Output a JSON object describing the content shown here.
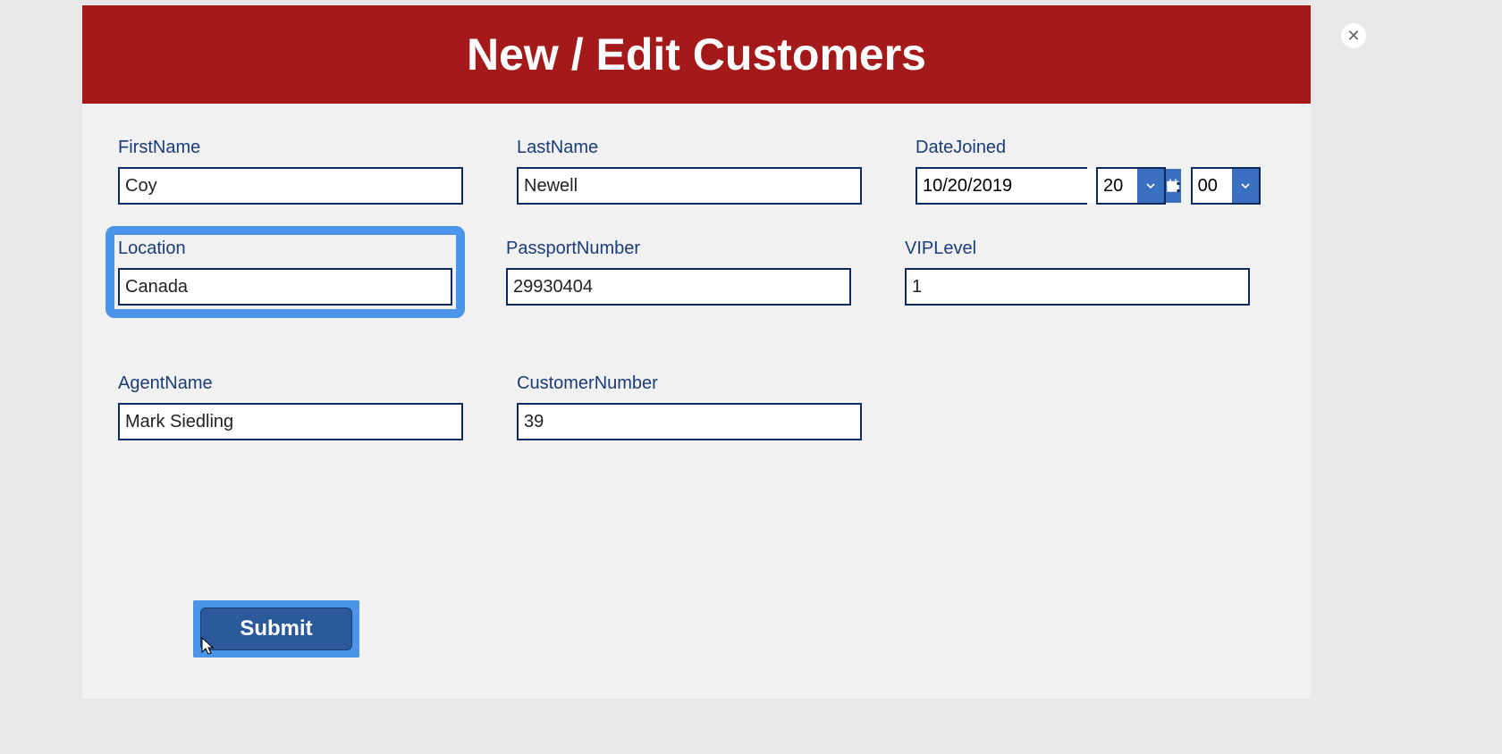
{
  "modal": {
    "title": "New / Edit Customers",
    "close_label": "✕"
  },
  "form": {
    "firstName": {
      "label": "FirstName",
      "value": "Coy"
    },
    "lastName": {
      "label": "LastName",
      "value": "Newell"
    },
    "dateJoined": {
      "label": "DateJoined",
      "date": "10/20/2019",
      "hour": "20",
      "minute": "00",
      "separator": ":"
    },
    "location": {
      "label": "Location",
      "value": "Canada"
    },
    "passportNumber": {
      "label": "PassportNumber",
      "value": "29930404"
    },
    "vipLevel": {
      "label": "VIPLevel",
      "value": "1"
    },
    "agentName": {
      "label": "AgentName",
      "value": "Mark Siedling"
    },
    "customerNumber": {
      "label": "CustomerNumber",
      "value": "39"
    }
  },
  "actions": {
    "submit_label": "Submit"
  }
}
